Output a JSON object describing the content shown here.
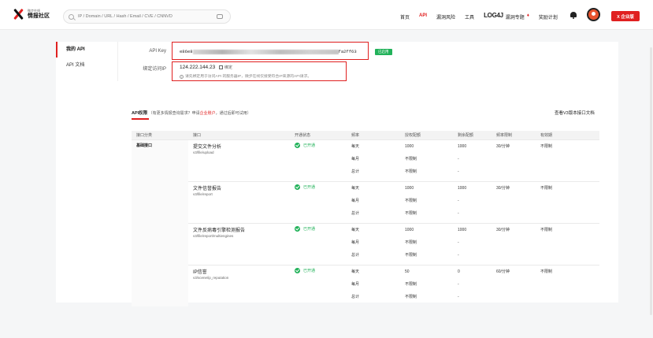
{
  "header": {
    "logo_small": "微步在线",
    "logo_big": "情报社区",
    "search_placeholder": "IP / Domain / URL / Hash / Email / CVE / CNNVD",
    "nav": [
      "首页",
      "API",
      "漏洞风险",
      "工具"
    ],
    "log4j_label": "LOG4J",
    "log4j_sub": "漏洞专题",
    "hot": "♦",
    "reward": "奖励计划",
    "enterprise_button": "X 企业版"
  },
  "sidebar": {
    "items": [
      {
        "label": "我的 API",
        "active": true
      },
      {
        "label": "API 文档",
        "active": false
      }
    ]
  },
  "api_key": {
    "label": "API Key",
    "prefix": "e86e8",
    "suffix": "fa2ff63",
    "status": "已启用"
  },
  "bind_ip": {
    "label": "绑定访问IP",
    "value": "124.222.144.23",
    "action": "绑定",
    "notice": "请先绑定用于访问API 的服务器IP，微步在线仅接受符合IP来源的API请求。"
  },
  "quota": {
    "title": "API权限",
    "hint_prefix": "（有更多情报查询需求？申请",
    "hint_link": "企业账户",
    "hint_suffix": "，通过后即可试用）",
    "docs_link": "查看V3版本接口文档"
  },
  "table": {
    "headers": [
      "接口分类",
      "接口",
      "开通状态",
      "频率",
      "授权配额",
      "剩余配额",
      "频率限制",
      "有效期"
    ],
    "category": "基础接口",
    "rows": [
      {
        "name": "提交文件分析",
        "path": "v3/file/upload",
        "status": "已开通",
        "periods": [
          "每天",
          "每月",
          "总计"
        ],
        "quota": [
          "1000",
          "不限制",
          "不限制"
        ],
        "remaining": [
          "1000",
          "-",
          "-"
        ],
        "rate": "30/分钟",
        "validity": "不限制"
      },
      {
        "name": "文件信誉报告",
        "path": "v3/file/report",
        "status": "已开通",
        "periods": [
          "每天",
          "每月",
          "总计"
        ],
        "quota": [
          "1000",
          "不限制",
          "不限制"
        ],
        "remaining": [
          "1000",
          "-",
          "-"
        ],
        "rate": "30/分钟",
        "validity": "不限制"
      },
      {
        "name": "文件反病毒引擎检测报告",
        "path": "v3/file/report/multiengines",
        "status": "已开通",
        "periods": [
          "每天",
          "每月",
          "总计"
        ],
        "quota": [
          "1000",
          "不限制",
          "不限制"
        ],
        "remaining": [
          "1000",
          "-",
          "-"
        ],
        "rate": "30/分钟",
        "validity": "不限制"
      },
      {
        "name": "IP信誉",
        "path": "v3/scene/ip_reputation",
        "status": "已开通",
        "periods": [
          "每天",
          "每月",
          "总计"
        ],
        "quota": [
          "50",
          "不限制",
          "不限制"
        ],
        "remaining": [
          "0",
          "-",
          "-"
        ],
        "rate": "60/分钟",
        "validity": "不限制"
      }
    ]
  },
  "colors": {
    "accent": "#e02020",
    "success": "#22b25a"
  }
}
